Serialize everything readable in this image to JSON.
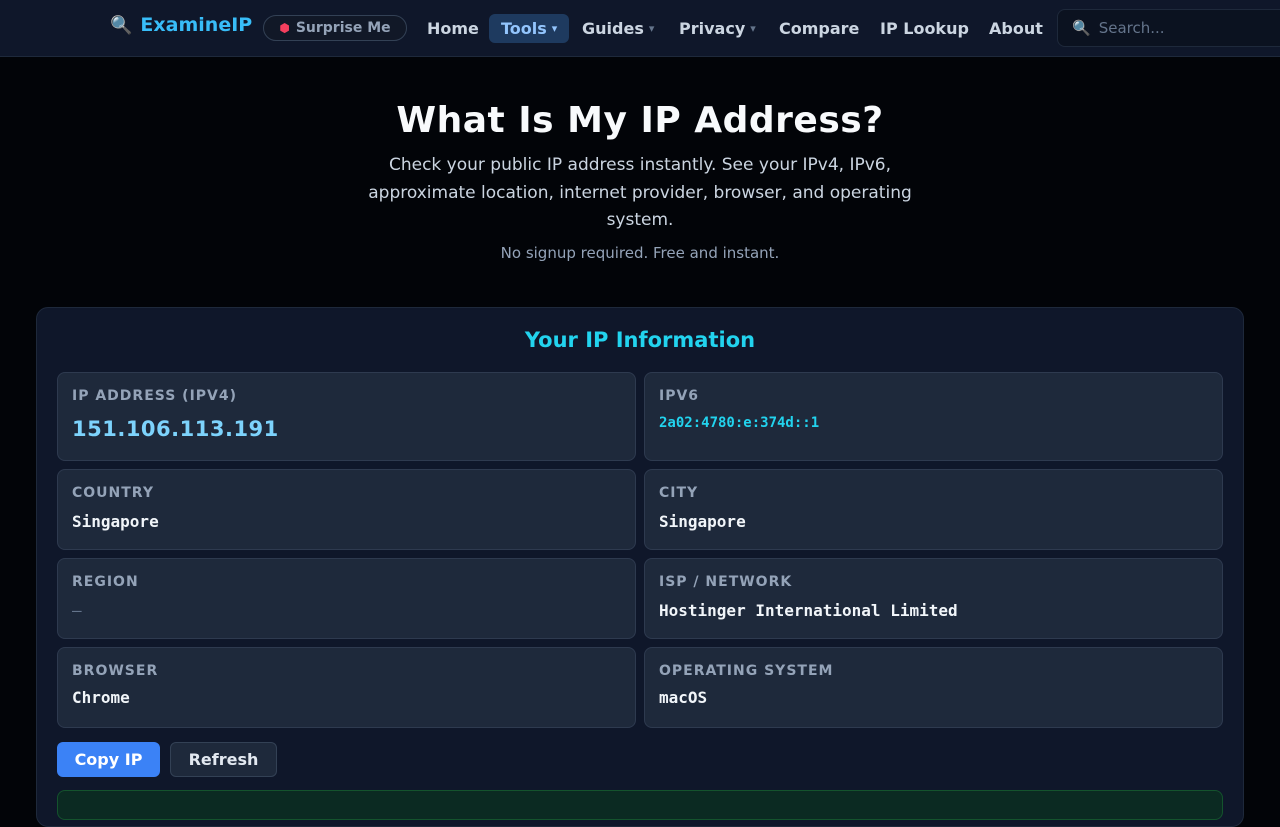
{
  "nav": {
    "brand": "ExamineIP",
    "surprise": "Surprise Me",
    "items": [
      {
        "label": "Home",
        "caret": ""
      },
      {
        "label": "Tools",
        "caret": "▾"
      },
      {
        "label": "Guides",
        "caret": "▾"
      },
      {
        "label": "Privacy",
        "caret": "▾"
      },
      {
        "label": "Compare",
        "caret": ""
      },
      {
        "label": "IP Lookup",
        "caret": ""
      },
      {
        "label": "About",
        "caret": ""
      }
    ],
    "active_item": "Tools",
    "search_placeholder": "Search..."
  },
  "hero": {
    "title": "What Is My IP Address?",
    "subtitle": "Check your public IP address instantly. See your IPv4, IPv6, approximate location, internet provider, browser, and operating system.",
    "note": "No signup required. Free and instant."
  },
  "info": {
    "title": "Your IP Information",
    "fields": [
      {
        "label": "IP ADDRESS (IPV4)",
        "value": "151.106.113.191"
      },
      {
        "label": "IPV6",
        "value": "2a02:4780:e:374d::1"
      },
      {
        "label": "COUNTRY",
        "value": "Singapore"
      },
      {
        "label": "CITY",
        "value": "Singapore"
      },
      {
        "label": "REGION",
        "value": "—"
      },
      {
        "label": "ISP / NETWORK",
        "value": "Hostinger International Limited"
      },
      {
        "label": "BROWSER",
        "value": "Chrome"
      },
      {
        "label": "OPERATING SYSTEM",
        "value": "macOS"
      }
    ],
    "copy_button": "Copy IP",
    "refresh_button": "Refresh"
  },
  "colors": {
    "accent": "#22d3ee",
    "brand": "#38bdf8",
    "primary_button": "#3b82f6",
    "background": "#020408"
  },
  "icons": {
    "brand": "magnifier-icon",
    "surprise": "dice-icon",
    "search": "magnifier-icon"
  }
}
